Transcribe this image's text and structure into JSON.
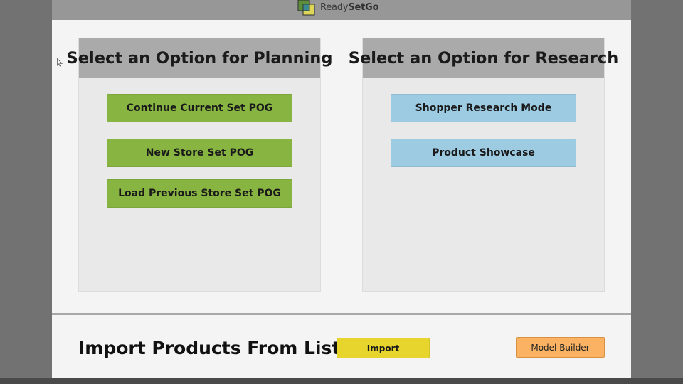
{
  "header": {
    "logo_name_regular": "Ready",
    "logo_name_bold": "SetGo"
  },
  "planning": {
    "title": "Select an Option for Planning",
    "buttons": [
      {
        "label": "Continue Current Set POG"
      },
      {
        "label": "New Store Set POG"
      },
      {
        "label": "Load Previous Store Set POG"
      }
    ]
  },
  "research": {
    "title": "Select an Option for Research",
    "buttons": [
      {
        "label": "Shopper Research Mode"
      },
      {
        "label": "Product Showcase"
      }
    ]
  },
  "import_section": {
    "title": "Import Products From List",
    "import_label": "Import",
    "model_builder_label": "Model Builder"
  },
  "colors": {
    "planning_button": "#88b441",
    "research_button": "#9ccbe2",
    "import_button": "#e7d52d",
    "model_builder_button": "#fbb263",
    "panel_header": "#aaaaaa",
    "header_bar": "#979797"
  },
  "icons": {
    "logo": "overlapping-squares-logo-icon",
    "cursor": "mouse-pointer-icon"
  }
}
